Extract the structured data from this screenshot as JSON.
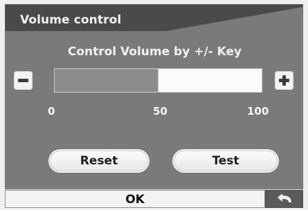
{
  "window": {
    "title": "Volume control"
  },
  "instruction": "Control Volume by +/- Key",
  "controls": {
    "minus_icon": "minus-icon",
    "plus_icon": "plus-icon"
  },
  "volume": {
    "min": 0,
    "max": 100,
    "current": 50,
    "fill_color": "#8b8b8b",
    "track_color": "#fbfbfb",
    "ticks": [
      "0",
      "50",
      "100"
    ]
  },
  "buttons": {
    "reset": "Reset",
    "test": "Test",
    "ok": "OK",
    "back_icon": "back-arrow-icon"
  },
  "colors": {
    "title_bar": "#4a4a4a",
    "panel": "#7a7a7a",
    "panel_border": "#5e5e5e",
    "light_text": "#f2f2f2",
    "button_bg": "#f3f3f3"
  }
}
